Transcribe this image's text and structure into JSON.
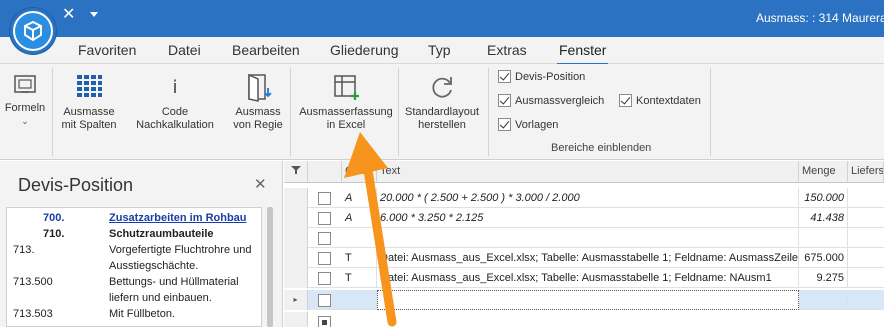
{
  "titlebar": {
    "title": "Ausmass: : 314 Maurerarbe"
  },
  "menu": {
    "tabs": [
      "Favoriten",
      "Datei",
      "Bearbeiten",
      "Gliederung",
      "Typ",
      "Extras",
      "Fenster"
    ],
    "active": "Fenster"
  },
  "ribbon": {
    "formeln": "Formeln",
    "ausmasse_spalten": [
      "Ausmasse",
      "mit Spalten"
    ],
    "code_nachkalk": "Code Nachkalkulation",
    "ausmass_regie": [
      "Ausmass",
      "von Regie"
    ],
    "ausmasserfassung": [
      "Ausmasserfassung",
      "in Excel"
    ],
    "standardlayout": [
      "Standardlayout",
      "herstellen"
    ],
    "checkboxes": [
      "Devis-Position",
      "Ausmassvergleich",
      "Vorlagen",
      "Kontextdaten"
    ],
    "group_label": "Bereiche einblenden",
    "accent": "#2b72c2"
  },
  "left_panel": {
    "title": "Devis-Position",
    "items": [
      {
        "num": "700.",
        "text": "Zusatzarbeiten im Rohbau"
      },
      {
        "num": "710.",
        "text": "Schutzraumbauteile"
      },
      {
        "num": "713.",
        "text": "Vorgefertigte Fluchtrohre und"
      },
      {
        "num": "",
        "text": "Ausstiegschächte."
      },
      {
        "num": "713.500",
        "text": "Bettungs- und Hüllmaterial"
      },
      {
        "num": "",
        "text": "liefern und einbauen."
      },
      {
        "num": "713.503",
        "text": "Mit Füllbeton."
      }
    ]
  },
  "grid": {
    "headers": [
      "Code",
      "Text",
      "Menge",
      "Liefers"
    ],
    "rows": [
      {
        "code": "A",
        "text": "20.000 * (  2.500 +  2.500 ) *  3.000 /  2.000",
        "menge": "150.000"
      },
      {
        "code": "A",
        "text": "6.000 *  3.250 *  2.125",
        "menge": "41.438"
      },
      {
        "code": "",
        "text": "",
        "menge": ""
      },
      {
        "code": "T",
        "text": "Datei: Ausmass_aus_Excel.xlsx; Tabelle: Ausmasstabelle 1; Feldname: AusmassZeile1",
        "menge": "675.000"
      },
      {
        "code": "T",
        "text": "Datei: Ausmass_aus_Excel.xlsx; Tabelle: Ausmasstabelle 1; Feldname: NAusm1",
        "menge": "9.275"
      },
      {
        "code": "",
        "text": "",
        "menge": ""
      },
      {
        "code": "",
        "text": "",
        "menge": ""
      }
    ]
  }
}
